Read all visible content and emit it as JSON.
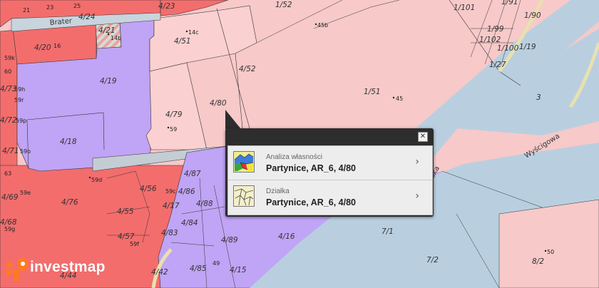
{
  "map": {
    "colors": {
      "background": "#f7c9c9",
      "red_parcel": "#f36d6d",
      "purple_parcel": "#c0a4f5",
      "pink_parcel": "#fbcaca",
      "road": "#b9cfe0",
      "grey_road": "#c4ccd4"
    },
    "streets": {
      "brater": "Brater",
      "wyscigowa": "Wyścigowa",
      "partial_street": "ska"
    },
    "parcel_labels": [
      "4/23",
      "4/24",
      "4/21",
      "4/20",
      "4/19",
      "4/51",
      "4/52",
      "4/80",
      "4/79",
      "4/18",
      "4/73",
      "4/72",
      "4/71",
      "4/69",
      "4/68",
      "4/76",
      "4/56",
      "4/55",
      "4/57",
      "4/87",
      "4/86",
      "4/17",
      "4/88",
      "4/83",
      "4/84",
      "4/89",
      "4/16",
      "4/85",
      "4/15",
      "4/42",
      "4/44",
      "1/52",
      "1/51",
      "1/101",
      "1/91",
      "1/99",
      "1/102",
      "1/100",
      "1/90",
      "1/19",
      "1/27",
      "3",
      "7/1",
      "7/2",
      "8/2"
    ],
    "address_numbers": [
      "21",
      "23",
      "25",
      "14b",
      "14c",
      "16",
      "45b",
      "45",
      "59",
      "59c",
      "59d",
      "59e",
      "59f",
      "59g",
      "59h",
      "59k",
      "59o",
      "59p",
      "59r",
      "49",
      "50",
      "60",
      "63"
    ]
  },
  "popup": {
    "close_symbol": "✕",
    "items": [
      {
        "icon": "ownership-analysis-icon",
        "title": "Analiza własności",
        "subtitle": "Partynice, AR_6, 4/80",
        "chevron": "›"
      },
      {
        "icon": "parcel-map-icon",
        "title": "Działka",
        "subtitle": "Partynice, AR_6, 4/80",
        "chevron": "›"
      }
    ]
  },
  "logo": {
    "text": "investmap",
    "accent": "#ff7a21"
  }
}
